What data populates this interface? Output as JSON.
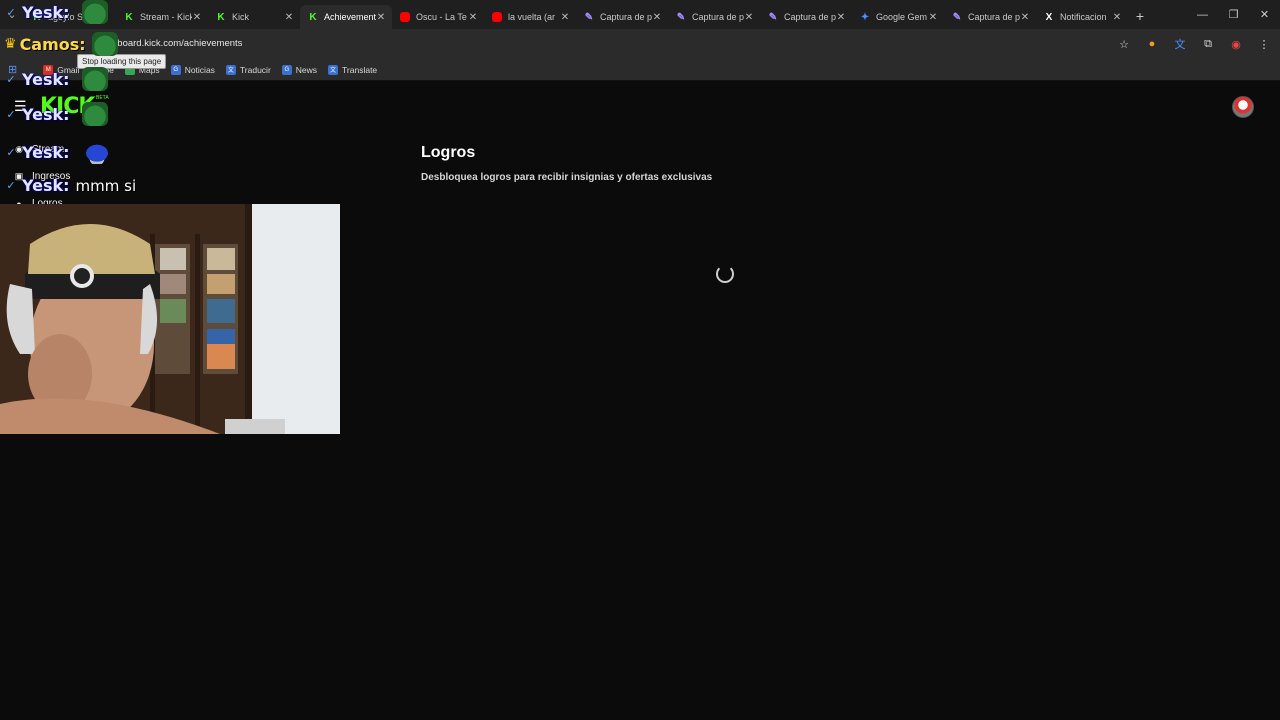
{
  "browser": {
    "tabs": [
      {
        "title": "ageylo Stre",
        "icon": "kick-icon",
        "active": false
      },
      {
        "title": "Stream - Kick",
        "icon": "kick-icon",
        "active": false
      },
      {
        "title": "Kick",
        "icon": "kick-icon",
        "active": false
      },
      {
        "title": "Achievements",
        "icon": "kick-icon",
        "active": true
      },
      {
        "title": "Oscu - La Te",
        "icon": "youtube-icon",
        "active": false
      },
      {
        "title": "la vuelta (ar",
        "icon": "youtube-icon",
        "active": false
      },
      {
        "title": "Captura de p",
        "icon": "pen-icon",
        "active": false
      },
      {
        "title": "Captura de p",
        "icon": "pen-icon",
        "active": false
      },
      {
        "title": "Captura de p",
        "icon": "pen-icon",
        "active": false
      },
      {
        "title": "Google Gem",
        "icon": "gemini-icon",
        "active": false
      },
      {
        "title": "Captura de p",
        "icon": "pen-icon",
        "active": false
      },
      {
        "title": "Notificacion",
        "icon": "x-icon",
        "active": false
      }
    ],
    "url": "hboard.kick.com/achievements",
    "tooltip": "Stop loading this page",
    "bookmarks": [
      "Gmail",
      "be",
      "Maps",
      "Noticias",
      "Traducir",
      "News",
      "Translate"
    ]
  },
  "page": {
    "logo": "KICK",
    "beta": "BETA",
    "sidebar": [
      "Stream",
      "Ingresos",
      "Logros"
    ],
    "title": "Logros",
    "subtitle": "Desbloquea logros para recibir insignias y ofertas exclusivas"
  },
  "overlay": {
    "camos_name": "Camos:",
    "chat": [
      {
        "user": "Yesk:",
        "message": ""
      },
      {
        "user": "Yesk:",
        "message": ""
      },
      {
        "user": "Yesk:",
        "message": ""
      },
      {
        "user": "Yesk:",
        "message": ""
      },
      {
        "user": "Yesk:",
        "message": "mmm si"
      }
    ]
  }
}
